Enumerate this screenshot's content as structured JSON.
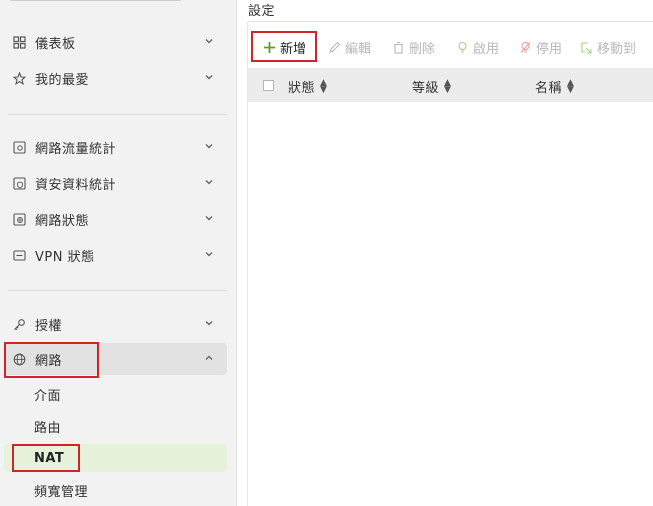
{
  "sidebar": {
    "items_top": [
      {
        "label": "儀表板",
        "icon": "dashboard-icon"
      },
      {
        "label": "我的最愛",
        "icon": "star-icon"
      }
    ],
    "items_mid": [
      {
        "label": "網路流量統計",
        "icon": "traffic-stats-icon"
      },
      {
        "label": "資安資料統計",
        "icon": "security-stats-icon"
      },
      {
        "label": "網路狀態",
        "icon": "network-status-icon"
      },
      {
        "label": "VPN 狀態",
        "icon": "vpn-status-icon"
      }
    ],
    "items_bottom": [
      {
        "label": "授權",
        "icon": "key-icon"
      },
      {
        "label": "網路",
        "icon": "globe-icon",
        "expanded": true
      }
    ],
    "network_sub": [
      {
        "label": "介面"
      },
      {
        "label": "路由"
      },
      {
        "label": "NAT",
        "active": true
      },
      {
        "label": "頻寬管理"
      }
    ]
  },
  "main": {
    "title": "設定",
    "toolbar": {
      "add": "新增",
      "edit": "編輯",
      "delete": "刪除",
      "enable": "啟用",
      "disable": "停用",
      "move": "移動到"
    },
    "table": {
      "columns": [
        "狀態",
        "等級",
        "名稱"
      ]
    }
  },
  "colors": {
    "accent_green": "#5aa02c",
    "highlight_red": "#d0242b",
    "active_bg": "#e6f2d9"
  }
}
